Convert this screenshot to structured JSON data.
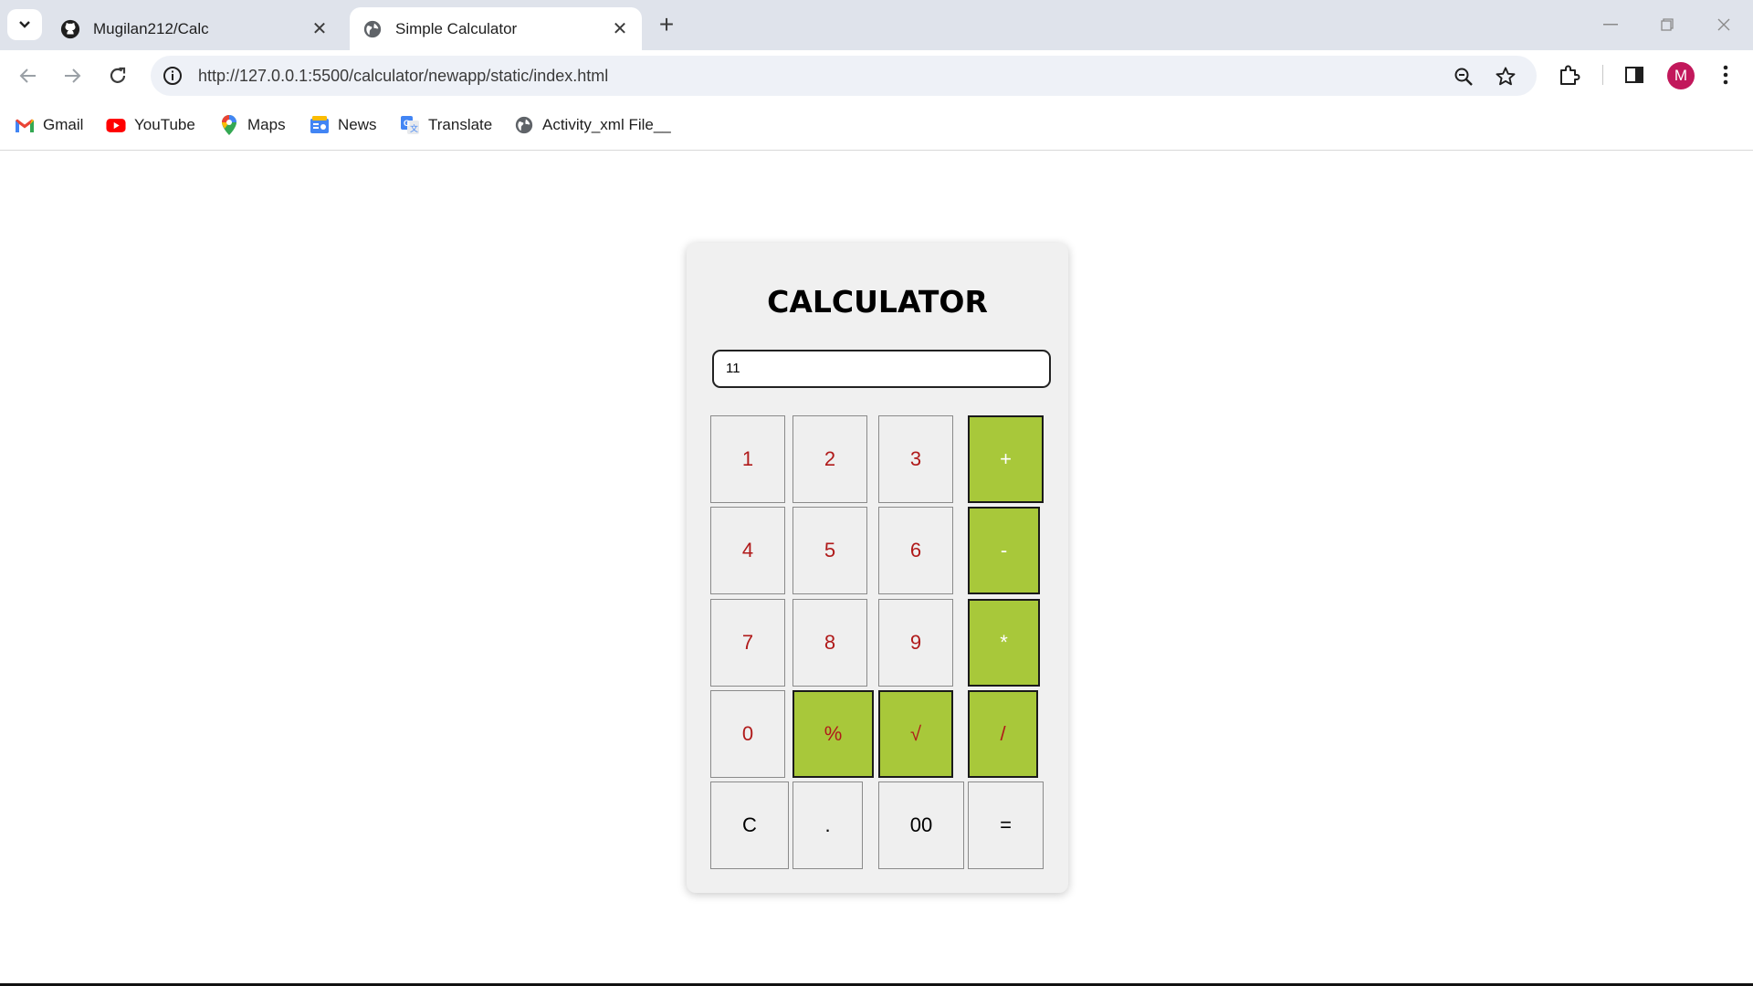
{
  "browser": {
    "tabs": [
      {
        "title": "Mugilan212/Calc",
        "active": false,
        "icon": "github-icon"
      },
      {
        "title": "Simple Calculator",
        "active": true,
        "icon": "globe-icon"
      }
    ],
    "url": "http://127.0.0.1:5500/calculator/newapp/static/index.html",
    "profile_initial": "M",
    "bookmarks": [
      {
        "label": "Gmail",
        "icon": "gmail-icon"
      },
      {
        "label": "YouTube",
        "icon": "youtube-icon"
      },
      {
        "label": "Maps",
        "icon": "maps-icon"
      },
      {
        "label": "News",
        "icon": "news-icon"
      },
      {
        "label": "Translate",
        "icon": "translate-icon"
      },
      {
        "label": "Activity_xml File__",
        "icon": "globe-icon"
      }
    ]
  },
  "calculator": {
    "title": "CALCULATOR",
    "display_value": "11",
    "keys": [
      [
        "1",
        "2",
        "3",
        "+"
      ],
      [
        "4",
        "5",
        "6",
        "-"
      ],
      [
        "7",
        "8",
        "9",
        "*"
      ],
      [
        "0",
        "%",
        "√",
        "/"
      ],
      [
        "C",
        ".",
        "00",
        "="
      ]
    ]
  },
  "colors": {
    "operator_key": "#a8c83a",
    "digit_text": "#b01a1a",
    "key_background": "#efefef"
  }
}
